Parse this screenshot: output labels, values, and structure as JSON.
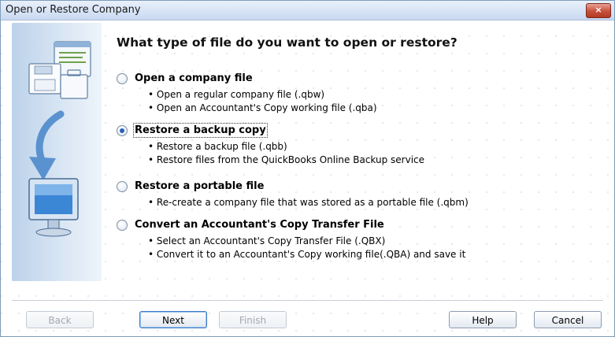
{
  "window": {
    "title": "Open or Restore Company",
    "close_glyph": "×"
  },
  "heading": "What type of file do you want to open or restore?",
  "options": [
    {
      "label": "Open a company file",
      "selected": false,
      "bullets": [
        "Open a regular company file (.qbw)",
        "Open an Accountant's Copy working file (.qba)"
      ]
    },
    {
      "label": "Restore a backup copy",
      "selected": true,
      "bullets": [
        "Restore a backup file (.qbb)",
        "Restore files from the QuickBooks Online Backup service"
      ]
    },
    {
      "label": "Restore a portable file",
      "selected": false,
      "bullets": [
        "Re-create a company file that was stored as a portable file (.qbm)"
      ]
    },
    {
      "label": "Convert an Accountant's Copy Transfer File",
      "selected": false,
      "bullets": [
        "Select an Accountant's Copy Transfer File (.QBX)",
        "Convert it to an Accountant's Copy working file(.QBA) and save it"
      ]
    }
  ],
  "buttons": {
    "back": "Back",
    "next": "Next",
    "finish": "Finish",
    "help": "Help",
    "cancel": "Cancel"
  },
  "icons": {
    "illustration": [
      "document-files-icon",
      "down-arrow-icon",
      "computer-monitor-icon"
    ]
  },
  "colors": {
    "accent_blue": "#2b5fb8",
    "close_red": "#c8503a",
    "panel_blue": "#bcd2ea"
  }
}
